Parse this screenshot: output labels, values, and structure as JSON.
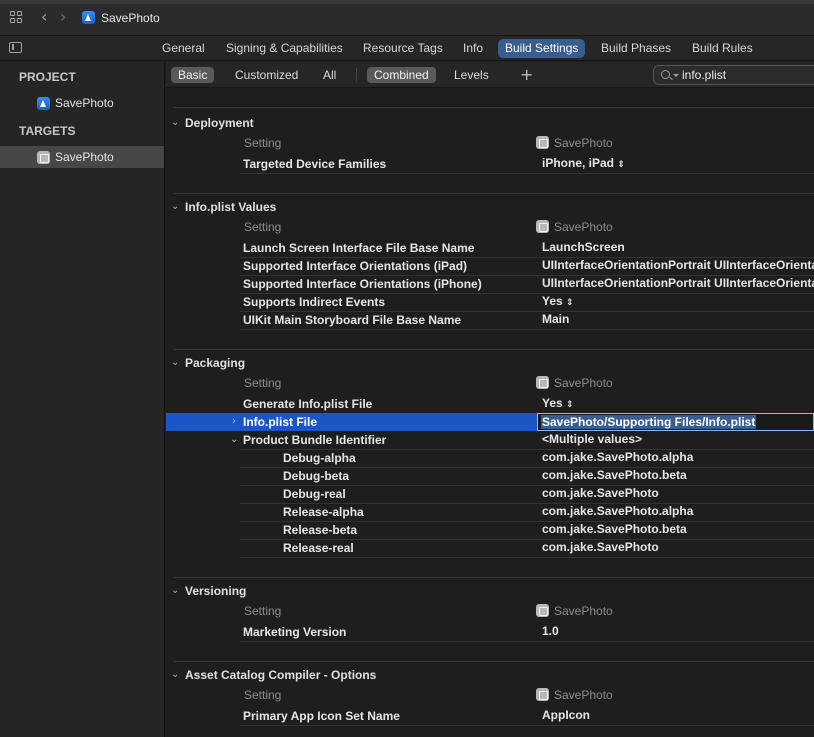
{
  "window": {
    "title": "SavePhoto"
  },
  "tabs": [
    "General",
    "Signing & Capabilities",
    "Resource Tags",
    "Info",
    "Build Settings",
    "Build Phases",
    "Build Rules"
  ],
  "active_tab": "Build Settings",
  "sidebar": {
    "project_header": "PROJECT",
    "project_item": "SavePhoto",
    "targets_header": "TARGETS",
    "target_item": "SavePhoto"
  },
  "filters": {
    "basic": "Basic",
    "customized": "Customized",
    "all": "All",
    "combined": "Combined",
    "levels": "Levels",
    "add": "+",
    "search_value": "info.plist"
  },
  "column_headers": {
    "setting": "Setting",
    "target": "SavePhoto"
  },
  "sections": {
    "deployment": {
      "title": "Deployment",
      "rows": [
        {
          "name": "Targeted Device Families",
          "value": "iPhone, iPad"
        }
      ]
    },
    "infoplist": {
      "title": "Info.plist Values",
      "rows": [
        {
          "name": "Launch Screen Interface File Base Name",
          "value": "LaunchScreen"
        },
        {
          "name": "Supported Interface Orientations (iPad)",
          "value": "UIInterfaceOrientationPortrait UIInterfaceOrientat"
        },
        {
          "name": "Supported Interface Orientations (iPhone)",
          "value": "UIInterfaceOrientationPortrait UIInterfaceOrientat"
        },
        {
          "name": "Supports Indirect Events",
          "value": "Yes"
        },
        {
          "name": "UIKit Main Storyboard File Base Name",
          "value": "Main"
        }
      ]
    },
    "packaging": {
      "title": "Packaging",
      "rows": [
        {
          "name": "Generate Info.plist File",
          "value": "Yes"
        },
        {
          "name": "Info.plist File",
          "value": "SavePhoto/Supporting Files/Info.plist"
        },
        {
          "name": "Product Bundle Identifier",
          "value": "<Multiple values>"
        },
        {
          "name": "Debug-alpha",
          "value": "com.jake.SavePhoto.alpha"
        },
        {
          "name": "Debug-beta",
          "value": "com.jake.SavePhoto.beta"
        },
        {
          "name": "Debug-real",
          "value": "com.jake.SavePhoto"
        },
        {
          "name": "Release-alpha",
          "value": "com.jake.SavePhoto.alpha"
        },
        {
          "name": "Release-beta",
          "value": "com.jake.SavePhoto.beta"
        },
        {
          "name": "Release-real",
          "value": "com.jake.SavePhoto"
        }
      ]
    },
    "versioning": {
      "title": "Versioning",
      "rows": [
        {
          "name": "Marketing Version",
          "value": "1.0"
        }
      ]
    },
    "assetcatalog": {
      "title": "Asset Catalog Compiler - Options",
      "rows": [
        {
          "name": "Primary App Icon Set Name",
          "value": "AppIcon"
        }
      ]
    }
  },
  "icons": {
    "updown": "⌃⌄",
    "chevron_down": "⌄",
    "chevron_right": "›",
    "back": "‹",
    "forward": "›"
  },
  "colors": {
    "accent": "#3a5d8f",
    "selection": "#1b56c7"
  }
}
